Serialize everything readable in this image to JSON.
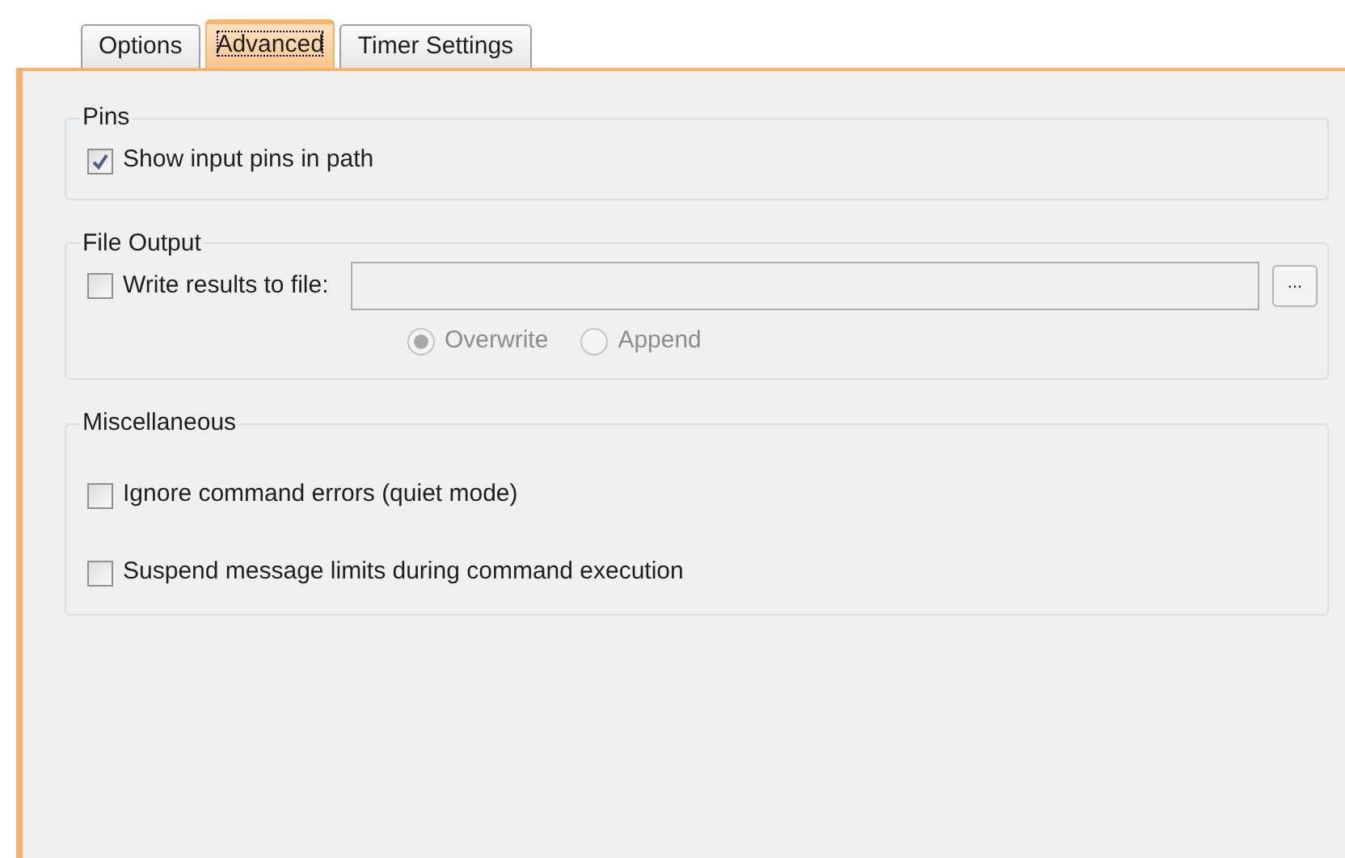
{
  "tabs": [
    {
      "label": "Options",
      "selected": false
    },
    {
      "label": "Advanced",
      "selected": true
    },
    {
      "label": "Timer Settings",
      "selected": false
    }
  ],
  "groups": [
    {
      "title": "Pins",
      "spacious": false,
      "items": [
        {
          "kind": "checkbox",
          "label": "Show input pins in path",
          "checked": true
        }
      ]
    },
    {
      "title": "File Output",
      "spacious": false,
      "items": [
        {
          "kind": "file_row",
          "label": "Write results to file:",
          "checked": false,
          "browse_button": "..."
        },
        {
          "kind": "radio_row",
          "disabled": true,
          "options": [
            {
              "label": "Overwrite",
              "selected": true
            },
            {
              "label": "Append",
              "selected": false
            }
          ]
        }
      ]
    },
    {
      "title": "Miscellaneous",
      "spacious": true,
      "items": [
        {
          "kind": "checkbox",
          "label": "Ignore command errors (quiet mode)",
          "checked": false
        },
        {
          "kind": "checkbox",
          "label": "Suspend message limits during command execution",
          "checked": false
        }
      ]
    }
  ]
}
